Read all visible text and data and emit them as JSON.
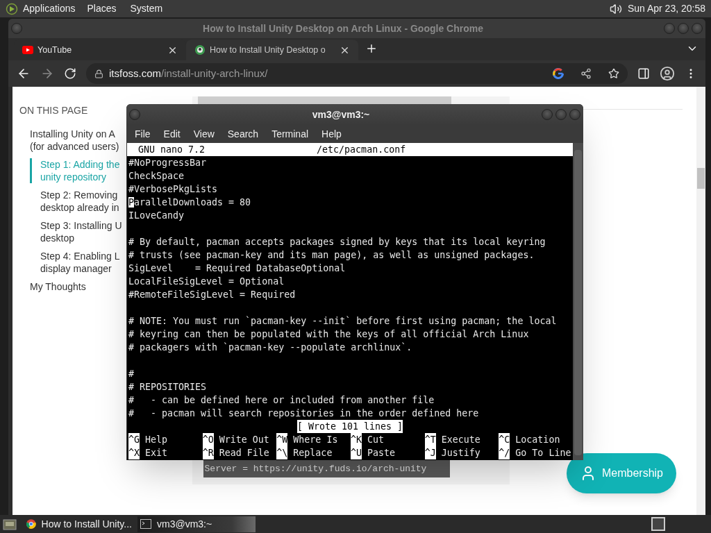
{
  "top_panel": {
    "menus": [
      "Applications",
      "Places",
      "System"
    ],
    "clock": "Sun Apr 23, 20:58"
  },
  "browser": {
    "title": "How to Install Unity Desktop on Arch Linux - Google Chrome",
    "tabs": [
      {
        "title": "YouTube",
        "kind": "youtube",
        "selected": false
      },
      {
        "title": "How to Install Unity Desktop o",
        "kind": "site",
        "selected": true
      }
    ],
    "address": {
      "domain": "itsfoss.com",
      "path": "/install-unity-arch-linux/"
    },
    "page": {
      "toc_heading": "ON THIS PAGE",
      "toc": [
        {
          "lines": [
            "Installing Unity on A",
            "(for advanced users)"
          ],
          "selected": false,
          "children": [
            {
              "lines": [
                "Step 1: Adding the",
                "unity repository"
              ],
              "selected": true
            },
            {
              "lines": [
                "Step 2: Removing",
                "desktop already in"
              ],
              "selected": false
            },
            {
              "lines": [
                "Step 3: Installing U",
                "desktop"
              ],
              "selected": false
            },
            {
              "lines": [
                "Step 4: Enabling L",
                "display manager"
              ],
              "selected": false
            }
          ]
        },
        {
          "lines": [
            "My Thoughts"
          ],
          "selected": false
        }
      ],
      "code_line": "Server = https://unity.fuds.io/arch-unity",
      "membership_button": "Membership"
    }
  },
  "terminal": {
    "title": "vm3@vm3:~",
    "menus": [
      "File",
      "Edit",
      "View",
      "Search",
      "Terminal",
      "Help"
    ],
    "nano": {
      "version": "GNU nano 7.2",
      "file": "/etc/pacman.conf",
      "lines": [
        {
          "kind": "text",
          "text": "#NoProgressBar",
          "cursor": false
        },
        {
          "kind": "text",
          "text": "CheckSpace",
          "cursor": false
        },
        {
          "kind": "text",
          "text": "#VerbosePkgLists",
          "cursor": false
        },
        {
          "kind": "text",
          "text": "ParallelDownloads = 80",
          "cursor": true
        },
        {
          "kind": "text",
          "text": "ILoveCandy",
          "cursor": false
        },
        {
          "kind": "blank"
        },
        {
          "kind": "text",
          "text": "# By default, pacman accepts packages signed by keys that its local keyring",
          "cursor": false
        },
        {
          "kind": "text",
          "text": "# trusts (see pacman-key and its man page), as well as unsigned packages.",
          "cursor": false
        },
        {
          "kind": "text",
          "text": "SigLevel    = Required DatabaseOptional",
          "cursor": false
        },
        {
          "kind": "text",
          "text": "LocalFileSigLevel = Optional",
          "cursor": false
        },
        {
          "kind": "text",
          "text": "#RemoteFileSigLevel = Required",
          "cursor": false
        },
        {
          "kind": "blank"
        },
        {
          "kind": "text",
          "text": "# NOTE: You must run `pacman-key --init` before first using pacman; the local",
          "cursor": false
        },
        {
          "kind": "text",
          "text": "# keyring can then be populated with the keys of all official Arch Linux",
          "cursor": false
        },
        {
          "kind": "text",
          "text": "# packagers with `pacman-key --populate archlinux`.",
          "cursor": false
        },
        {
          "kind": "blank"
        },
        {
          "kind": "text",
          "text": "#",
          "cursor": false
        },
        {
          "kind": "text",
          "text": "# REPOSITORIES",
          "cursor": false
        },
        {
          "kind": "text",
          "text": "#   - can be defined here or included from another file",
          "cursor": false
        },
        {
          "kind": "text",
          "text": "#   - pacman will search repositories in the order defined here",
          "cursor": false
        }
      ],
      "status": "[ Wrote 101 lines ]",
      "shortcuts": [
        {
          "key": "^G",
          "label": "Help"
        },
        {
          "key": "^O",
          "label": "Write Out"
        },
        {
          "key": "^W",
          "label": "Where Is"
        },
        {
          "key": "^K",
          "label": "Cut"
        },
        {
          "key": "^T",
          "label": "Execute"
        },
        {
          "key": "^C",
          "label": "Location"
        },
        {
          "key": "^X",
          "label": "Exit"
        },
        {
          "key": "^R",
          "label": "Read File"
        },
        {
          "key": "^\\",
          "label": "Replace"
        },
        {
          "key": "^U",
          "label": "Paste"
        },
        {
          "key": "^J",
          "label": "Justify"
        },
        {
          "key": "^/",
          "label": "Go To Line"
        }
      ]
    }
  },
  "taskbar": {
    "tasks": [
      {
        "title": "How to Install Unity...",
        "kind": "chrome",
        "selected": false
      },
      {
        "title": "vm3@vm3:~",
        "kind": "terminal",
        "selected": true
      }
    ]
  }
}
